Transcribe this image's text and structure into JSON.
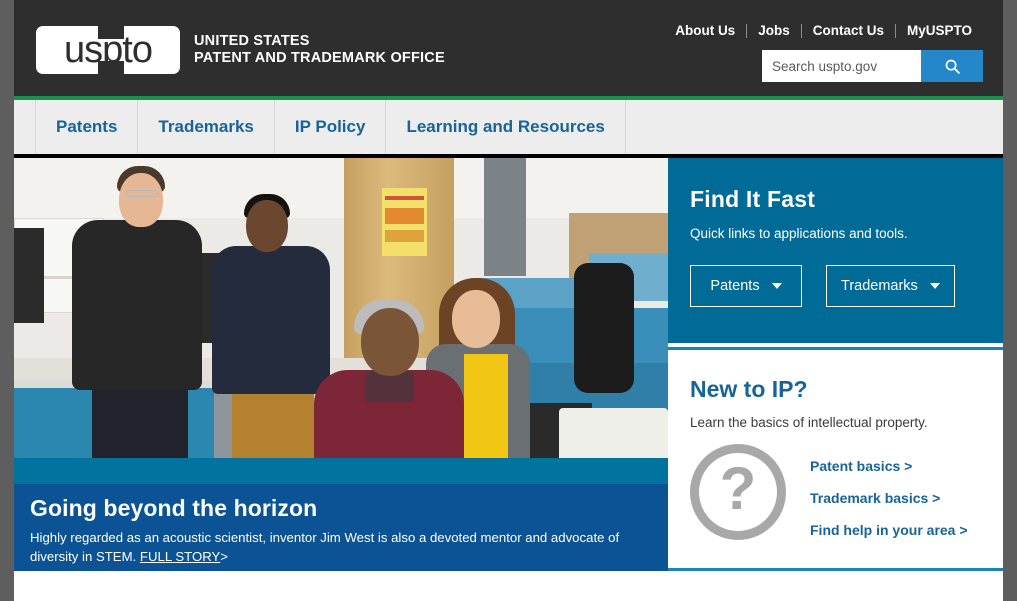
{
  "header": {
    "logo_text": "uspto",
    "agency_line1": "UNITED STATES",
    "agency_line2": "PATENT AND TRADEMARK OFFICE",
    "util_links": [
      {
        "label": "About Us"
      },
      {
        "label": "Jobs"
      },
      {
        "label": "Contact Us"
      },
      {
        "label": "MyUSPTO"
      }
    ],
    "search": {
      "placeholder": "Search uspto.gov",
      "value": "",
      "icon": "search-icon"
    },
    "colors": {
      "background": "#2e2e2e",
      "accent_rule": "#19914a",
      "search_button": "#2387c9"
    }
  },
  "main_nav": {
    "items": [
      {
        "label": "Patents"
      },
      {
        "label": "Trademarks"
      },
      {
        "label": "IP Policy"
      },
      {
        "label": "Learning and Resources"
      }
    ],
    "colors": {
      "background": "#ededed",
      "link": "#17649b"
    }
  },
  "hero": {
    "image_alt": "Four researchers working together in a laboratory with blue equipment benches",
    "title": "Going beyond the horizon",
    "description_before_link": "Highly regarded as an acoustic scientist, inventor Jim West is also a devoted mentor and advocate of diversity in STEM. ",
    "link_label": "FULL STORY",
    "link_chevron": ">",
    "colors": {
      "band": "#00749e",
      "caption": "#0b5394"
    }
  },
  "find_it_fast": {
    "title": "Find It Fast",
    "subtitle": "Quick links to applications and tools.",
    "buttons": [
      {
        "label": "Patents",
        "icon": "chevron-down-icon"
      },
      {
        "label": "Trademarks",
        "icon": "chevron-down-icon"
      }
    ],
    "colors": {
      "background": "#006b96"
    }
  },
  "new_to_ip": {
    "title": "New to IP?",
    "subtitle": "Learn the basics of intellectual property.",
    "icon": "question-mark-circle-icon",
    "icon_glyph": "?",
    "links": [
      {
        "label": "Patent basics >"
      },
      {
        "label": "Trademark basics >"
      },
      {
        "label": "Find help in your area >"
      }
    ],
    "colors": {
      "title": "#17649b",
      "border": "#1b86b5",
      "icon": "#a8a8a8"
    }
  }
}
